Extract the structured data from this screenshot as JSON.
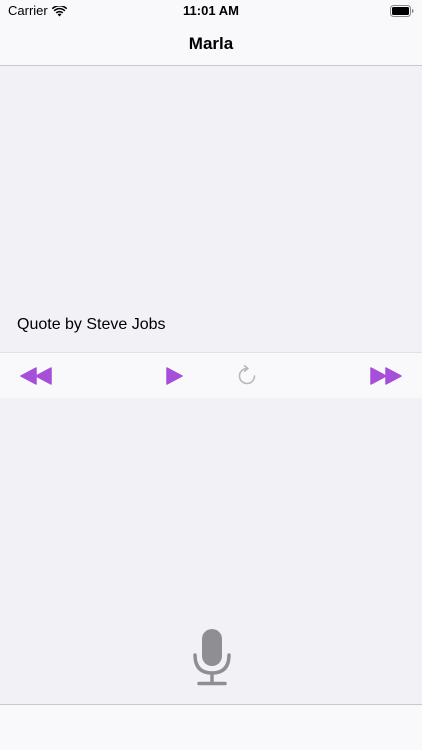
{
  "status_bar": {
    "carrier": "Carrier",
    "time": "11:01 AM",
    "wifi_icon": "wifi-icon",
    "battery_icon": "battery-icon"
  },
  "nav": {
    "title": "Marla"
  },
  "content": {
    "quote_label": "Quote by Steve Jobs"
  },
  "controls": {
    "rewind_icon": "rewind-icon",
    "play_icon": "play-icon",
    "replay_icon": "replay-icon",
    "forward_icon": "fast-forward-icon"
  },
  "mic": {
    "icon": "microphone-icon"
  },
  "colors": {
    "accent": "#a64fd8",
    "disabled": "#b8b8bc",
    "mic": "#8e8e93",
    "background": "#f2f1f6",
    "bar": "#f9f9fb"
  }
}
